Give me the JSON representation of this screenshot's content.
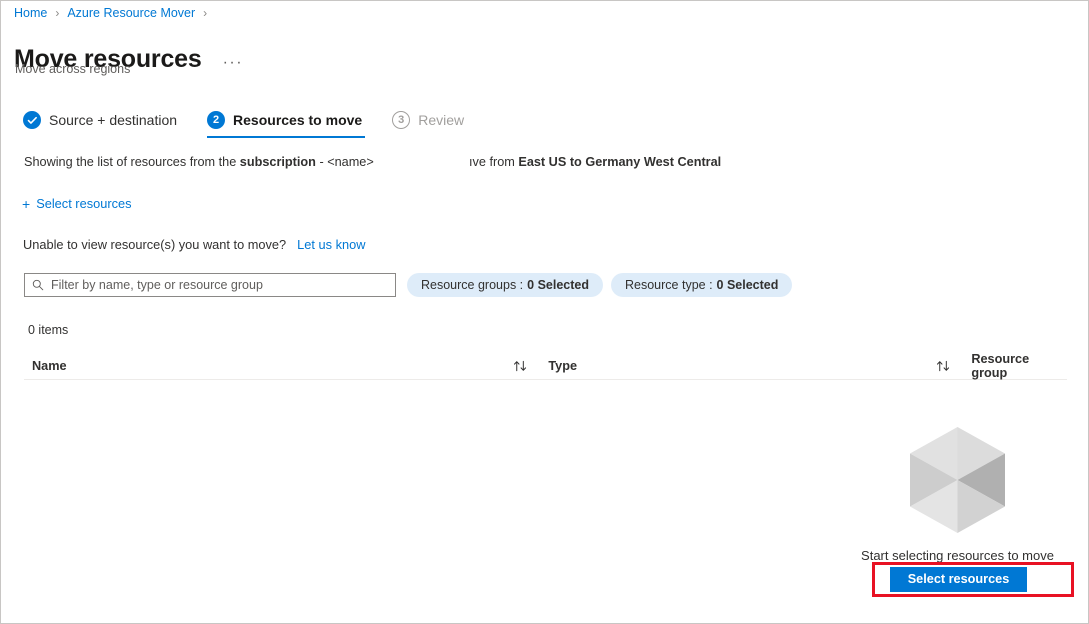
{
  "breadcrumb": {
    "items": [
      {
        "label": "Home"
      },
      {
        "label": "Azure Resource Mover"
      }
    ],
    "separator": "›"
  },
  "header": {
    "title": "Move resources",
    "subtitle": "Move across regions",
    "more_label": "···"
  },
  "stepper": {
    "steps": [
      {
        "badge": "✓",
        "label": "Source + destination",
        "state": "done"
      },
      {
        "badge": "2",
        "label": "Resources to move",
        "state": "active"
      },
      {
        "badge": "3",
        "label": "Review",
        "state": "todo"
      }
    ]
  },
  "info": {
    "line1_prefix": "Showing the list of resources from the ",
    "line1_bold": "subscription",
    "line1_suffix": " - <name>",
    "line2_prefix": "ıve from ",
    "line2_bold": "East US to Germany West Central"
  },
  "commands": {
    "select_resources_plus": "+",
    "select_resources_label": "Select resources"
  },
  "notice": {
    "text": "Unable to view resource(s) you want to move?",
    "link_label": "Let us know"
  },
  "filters": {
    "search_placeholder": "Filter by name, type or resource group",
    "search_value": "",
    "pills": [
      {
        "label": "Resource groups :",
        "value": "0 Selected"
      },
      {
        "label": "Resource type :",
        "value": "0 Selected"
      }
    ]
  },
  "table": {
    "count_label": "0 items",
    "columns": [
      {
        "label": "Name",
        "sortable": true
      },
      {
        "label": "Type",
        "sortable": true
      },
      {
        "label": "Resource group",
        "sortable": false
      }
    ],
    "rows": []
  },
  "empty_state": {
    "illustration": "cube-icon",
    "message": "Start selecting resources to move",
    "button_label": "Select resources"
  },
  "colors": {
    "accent": "#0078d4",
    "link": "#0078d4",
    "pill_background": "#deecf9",
    "highlight": "#e81123",
    "text": "#323130",
    "muted": "#605e5c"
  }
}
